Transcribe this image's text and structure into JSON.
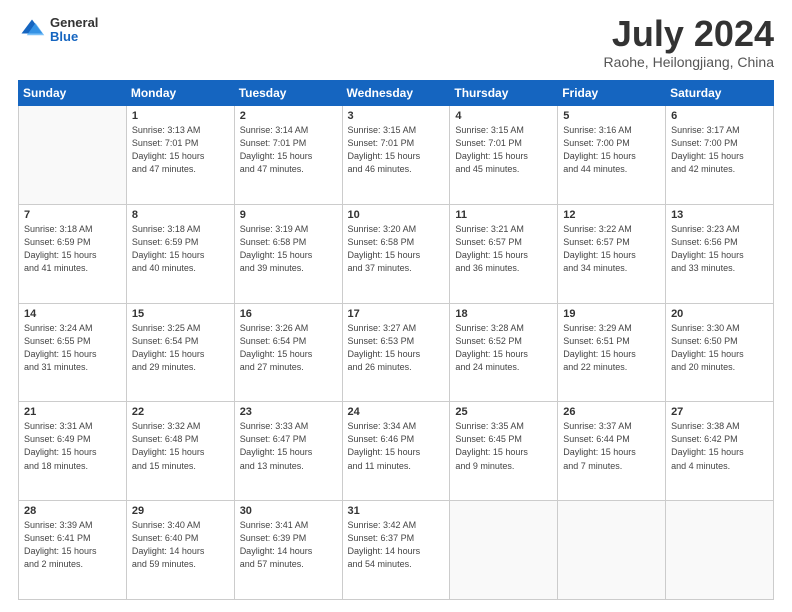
{
  "header": {
    "logo": {
      "general": "General",
      "blue": "Blue"
    },
    "title": "July 2024",
    "location": "Raohe, Heilongjiang, China"
  },
  "weekdays": [
    "Sunday",
    "Monday",
    "Tuesday",
    "Wednesday",
    "Thursday",
    "Friday",
    "Saturday"
  ],
  "weeks": [
    [
      {
        "day": "",
        "info": ""
      },
      {
        "day": "1",
        "info": "Sunrise: 3:13 AM\nSunset: 7:01 PM\nDaylight: 15 hours\nand 47 minutes."
      },
      {
        "day": "2",
        "info": "Sunrise: 3:14 AM\nSunset: 7:01 PM\nDaylight: 15 hours\nand 47 minutes."
      },
      {
        "day": "3",
        "info": "Sunrise: 3:15 AM\nSunset: 7:01 PM\nDaylight: 15 hours\nand 46 minutes."
      },
      {
        "day": "4",
        "info": "Sunrise: 3:15 AM\nSunset: 7:01 PM\nDaylight: 15 hours\nand 45 minutes."
      },
      {
        "day": "5",
        "info": "Sunrise: 3:16 AM\nSunset: 7:00 PM\nDaylight: 15 hours\nand 44 minutes."
      },
      {
        "day": "6",
        "info": "Sunrise: 3:17 AM\nSunset: 7:00 PM\nDaylight: 15 hours\nand 42 minutes."
      }
    ],
    [
      {
        "day": "7",
        "info": "Sunrise: 3:18 AM\nSunset: 6:59 PM\nDaylight: 15 hours\nand 41 minutes."
      },
      {
        "day": "8",
        "info": "Sunrise: 3:18 AM\nSunset: 6:59 PM\nDaylight: 15 hours\nand 40 minutes."
      },
      {
        "day": "9",
        "info": "Sunrise: 3:19 AM\nSunset: 6:58 PM\nDaylight: 15 hours\nand 39 minutes."
      },
      {
        "day": "10",
        "info": "Sunrise: 3:20 AM\nSunset: 6:58 PM\nDaylight: 15 hours\nand 37 minutes."
      },
      {
        "day": "11",
        "info": "Sunrise: 3:21 AM\nSunset: 6:57 PM\nDaylight: 15 hours\nand 36 minutes."
      },
      {
        "day": "12",
        "info": "Sunrise: 3:22 AM\nSunset: 6:57 PM\nDaylight: 15 hours\nand 34 minutes."
      },
      {
        "day": "13",
        "info": "Sunrise: 3:23 AM\nSunset: 6:56 PM\nDaylight: 15 hours\nand 33 minutes."
      }
    ],
    [
      {
        "day": "14",
        "info": "Sunrise: 3:24 AM\nSunset: 6:55 PM\nDaylight: 15 hours\nand 31 minutes."
      },
      {
        "day": "15",
        "info": "Sunrise: 3:25 AM\nSunset: 6:54 PM\nDaylight: 15 hours\nand 29 minutes."
      },
      {
        "day": "16",
        "info": "Sunrise: 3:26 AM\nSunset: 6:54 PM\nDaylight: 15 hours\nand 27 minutes."
      },
      {
        "day": "17",
        "info": "Sunrise: 3:27 AM\nSunset: 6:53 PM\nDaylight: 15 hours\nand 26 minutes."
      },
      {
        "day": "18",
        "info": "Sunrise: 3:28 AM\nSunset: 6:52 PM\nDaylight: 15 hours\nand 24 minutes."
      },
      {
        "day": "19",
        "info": "Sunrise: 3:29 AM\nSunset: 6:51 PM\nDaylight: 15 hours\nand 22 minutes."
      },
      {
        "day": "20",
        "info": "Sunrise: 3:30 AM\nSunset: 6:50 PM\nDaylight: 15 hours\nand 20 minutes."
      }
    ],
    [
      {
        "day": "21",
        "info": "Sunrise: 3:31 AM\nSunset: 6:49 PM\nDaylight: 15 hours\nand 18 minutes."
      },
      {
        "day": "22",
        "info": "Sunrise: 3:32 AM\nSunset: 6:48 PM\nDaylight: 15 hours\nand 15 minutes."
      },
      {
        "day": "23",
        "info": "Sunrise: 3:33 AM\nSunset: 6:47 PM\nDaylight: 15 hours\nand 13 minutes."
      },
      {
        "day": "24",
        "info": "Sunrise: 3:34 AM\nSunset: 6:46 PM\nDaylight: 15 hours\nand 11 minutes."
      },
      {
        "day": "25",
        "info": "Sunrise: 3:35 AM\nSunset: 6:45 PM\nDaylight: 15 hours\nand 9 minutes."
      },
      {
        "day": "26",
        "info": "Sunrise: 3:37 AM\nSunset: 6:44 PM\nDaylight: 15 hours\nand 7 minutes."
      },
      {
        "day": "27",
        "info": "Sunrise: 3:38 AM\nSunset: 6:42 PM\nDaylight: 15 hours\nand 4 minutes."
      }
    ],
    [
      {
        "day": "28",
        "info": "Sunrise: 3:39 AM\nSunset: 6:41 PM\nDaylight: 15 hours\nand 2 minutes."
      },
      {
        "day": "29",
        "info": "Sunrise: 3:40 AM\nSunset: 6:40 PM\nDaylight: 14 hours\nand 59 minutes."
      },
      {
        "day": "30",
        "info": "Sunrise: 3:41 AM\nSunset: 6:39 PM\nDaylight: 14 hours\nand 57 minutes."
      },
      {
        "day": "31",
        "info": "Sunrise: 3:42 AM\nSunset: 6:37 PM\nDaylight: 14 hours\nand 54 minutes."
      },
      {
        "day": "",
        "info": ""
      },
      {
        "day": "",
        "info": ""
      },
      {
        "day": "",
        "info": ""
      }
    ]
  ]
}
